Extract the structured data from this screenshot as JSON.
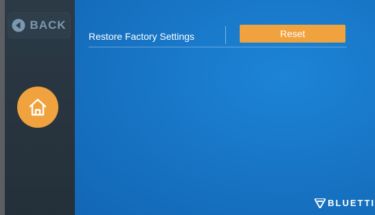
{
  "sidebar": {
    "back_label": "BACK",
    "back_icon": "back-arrow-icon",
    "home_icon": "home-icon"
  },
  "main": {
    "setting_label": "Restore Factory Settings",
    "reset_label": "Reset"
  },
  "brand": {
    "name": "BLUETTI",
    "logo_icon": "bluetti-logo-icon"
  },
  "colors": {
    "sidebar": "#2c3a46",
    "main_bg": "#1773c3",
    "accent": "#f0a23f",
    "back_text": "#7b98b1"
  }
}
